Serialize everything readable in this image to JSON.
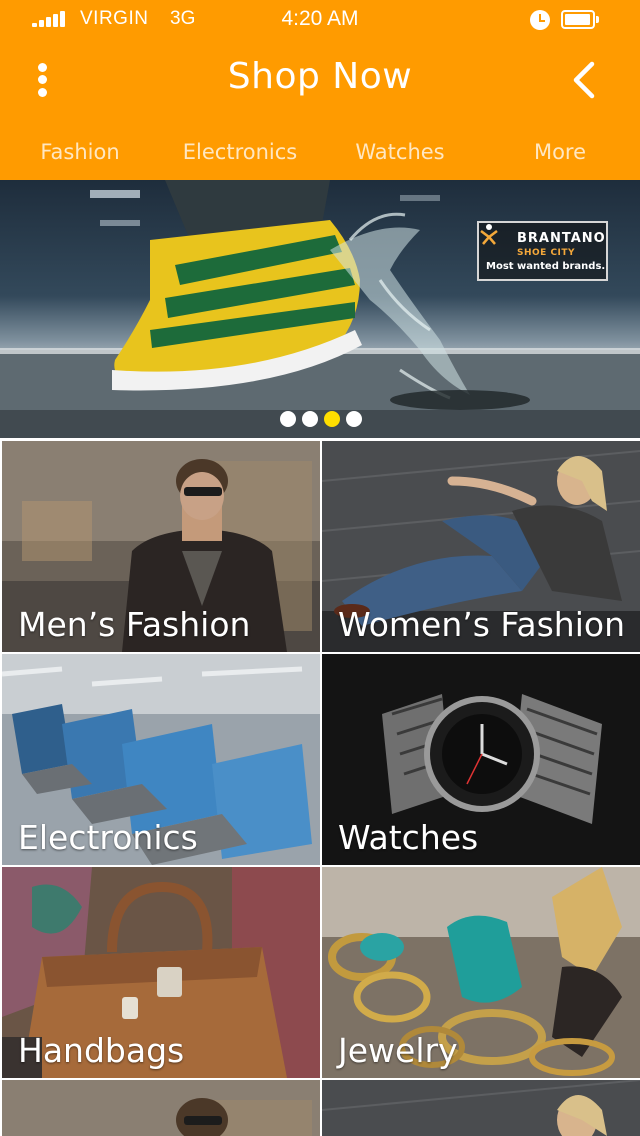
{
  "status_bar": {
    "carrier": "VIRGIN",
    "network": "3G",
    "time": "4:20 AM",
    "icons": [
      "signal-icon",
      "alarm-icon",
      "battery-icon"
    ]
  },
  "header": {
    "title": "Shop Now",
    "menu_icon": "more-vertical-icon",
    "back_icon": "chevron-left-icon",
    "background_color": "#ff9b00"
  },
  "tabs": [
    {
      "label": "Fashion"
    },
    {
      "label": "Electronics"
    },
    {
      "label": "Watches"
    },
    {
      "label": "More"
    }
  ],
  "banner": {
    "brand_name": "BRANTANO",
    "brand_sub": "SHOE CITY",
    "brand_tagline": "Most wanted brands.",
    "slide_count": 4,
    "active_slide": 3,
    "dot_active_color": "#ffde00"
  },
  "categories": [
    {
      "label": "Men’s Fashion"
    },
    {
      "label": "Women’s Fashion"
    },
    {
      "label": "Electronics"
    },
    {
      "label": "Watches"
    },
    {
      "label": "Handbags"
    },
    {
      "label": "Jewelry"
    },
    {
      "label": ""
    },
    {
      "label": ""
    }
  ]
}
